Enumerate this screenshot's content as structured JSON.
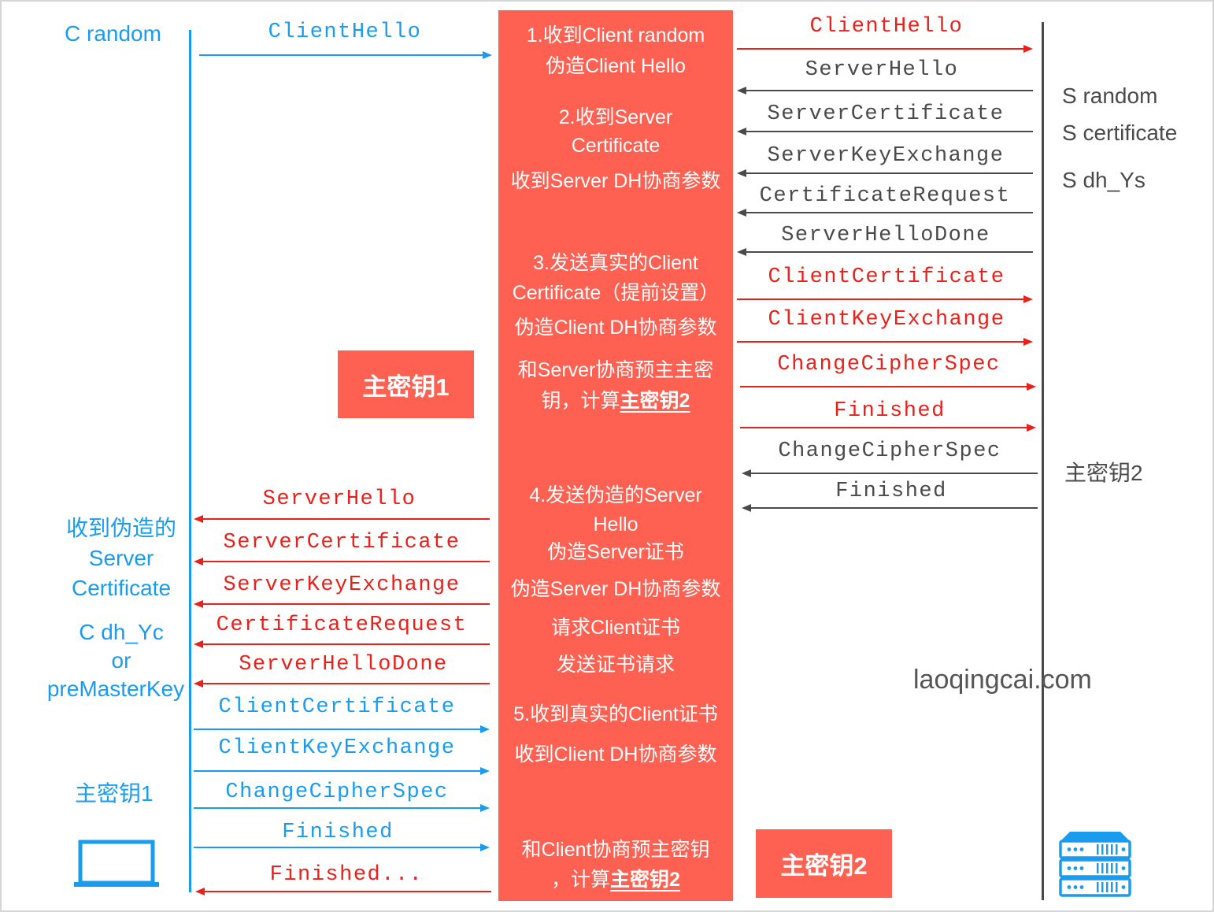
{
  "colors": {
    "client": "#1a9cee",
    "attacker": "#e8211b",
    "server": "#4a4a4a",
    "mitm_bg": "#fe6152",
    "mitm_text": "#ffffff",
    "watermark": "#555555"
  },
  "client_side": {
    "top_label": "C random",
    "middle_labels": [
      "收到伪造的",
      "Server",
      "Certificate",
      "C dh_Yc",
      "or",
      "preMasterKey"
    ],
    "bottom_label": "主密钥1",
    "device_icon": "laptop-icon"
  },
  "server_side": {
    "top_labels": [
      "S random",
      "S certificate",
      "S dh_Ys"
    ],
    "middle_label": "主密钥2",
    "device_icon": "server-rack-icon"
  },
  "master_key_1_box": "主密钥1",
  "master_key_2_box": "主密钥2",
  "mitm_steps": [
    {
      "lines": [
        "1.收到Client random",
        "伪造Client Hello"
      ]
    },
    {
      "lines": [
        "2.收到Server",
        "Certificate"
      ]
    },
    {
      "lines": [
        "收到Server DH协商参数"
      ]
    },
    {
      "lines": [
        "3.发送真实的Client",
        "Certificate（提前设置）"
      ]
    },
    {
      "lines": [
        "伪造Client DH协商参数"
      ]
    },
    {
      "lines": [
        "和Server协商预主主密"
      ]
    },
    {
      "lines": [
        "钥，计算",
        "主密钥2"
      ]
    },
    {
      "lines": [
        "4.发送伪造的Server",
        "Hello"
      ]
    },
    {
      "lines": [
        "伪造Server证书"
      ]
    },
    {
      "lines": [
        "伪造Server DH协商参数"
      ]
    },
    {
      "lines": [
        "请求Client证书"
      ]
    },
    {
      "lines": [
        "发送证书请求"
      ]
    },
    {
      "lines": [
        "5.收到真实的Client证书"
      ]
    },
    {
      "lines": [
        "收到Client DH协商参数"
      ]
    },
    {
      "lines": [
        "和Client协商预主密钥"
      ]
    },
    {
      "lines": [
        "，计算",
        "主密钥2"
      ]
    }
  ],
  "left_messages": [
    {
      "label": "ClientHello",
      "direction": "right",
      "color": "client"
    },
    {
      "label": "ServerHello",
      "direction": "left",
      "color": "attacker"
    },
    {
      "label": "ServerCertificate",
      "direction": "left",
      "color": "attacker"
    },
    {
      "label": "ServerKeyExchange",
      "direction": "left",
      "color": "attacker"
    },
    {
      "label": "CertificateRequest",
      "direction": "left",
      "color": "attacker"
    },
    {
      "label": "ServerHelloDone",
      "direction": "left",
      "color": "attacker"
    },
    {
      "label": "ClientCertificate",
      "direction": "right",
      "color": "client"
    },
    {
      "label": "ClientKeyExchange",
      "direction": "right",
      "color": "client"
    },
    {
      "label": "ChangeCipherSpec",
      "direction": "right",
      "color": "client"
    },
    {
      "label": "Finished",
      "direction": "right",
      "color": "client"
    },
    {
      "label": "Finished...",
      "direction": "left",
      "color": "attacker"
    }
  ],
  "right_messages": [
    {
      "label": "ClientHello",
      "direction": "right",
      "color": "attacker"
    },
    {
      "label": "ServerHello",
      "direction": "left",
      "color": "server"
    },
    {
      "label": "ServerCertificate",
      "direction": "left",
      "color": "server"
    },
    {
      "label": "ServerKeyExchange",
      "direction": "left",
      "color": "server"
    },
    {
      "label": "CertificateRequest",
      "direction": "left",
      "color": "server"
    },
    {
      "label": "ServerHelloDone",
      "direction": "left",
      "color": "server"
    },
    {
      "label": "ClientCertificate",
      "direction": "right",
      "color": "attacker"
    },
    {
      "label": "ClientKeyExchange",
      "direction": "right",
      "color": "attacker"
    },
    {
      "label": "ChangeCipherSpec",
      "direction": "right",
      "color": "attacker"
    },
    {
      "label": "Finished",
      "direction": "right",
      "color": "attacker"
    },
    {
      "label": "ChangeCipherSpec",
      "direction": "left",
      "color": "server"
    },
    {
      "label": "Finished",
      "direction": "left",
      "color": "server"
    }
  ],
  "watermark": "laoqingcai.com"
}
